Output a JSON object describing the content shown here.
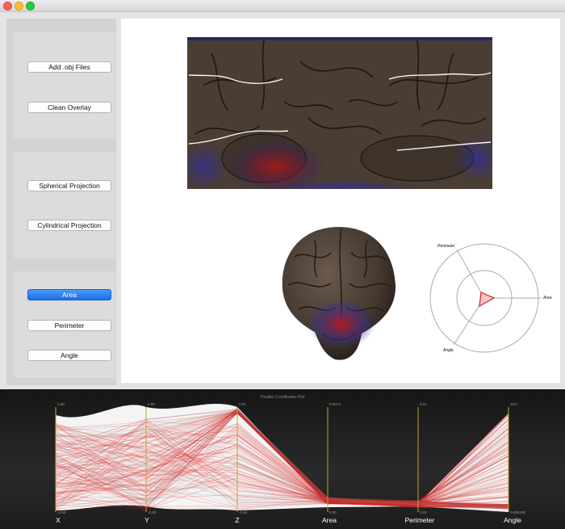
{
  "sidebar": {
    "add_obj_label": "Add .obj Files",
    "clean_overlay_label": "Clean Overlay",
    "spherical_label": "Spherical Projection",
    "cylindrical_label": "Cylindrical Projection",
    "area_label": "Area",
    "perimeter_label": "Perimeter",
    "angle_label": "Angle"
  },
  "radar": {
    "axes": [
      "Perimeter",
      "Area",
      "Angle"
    ]
  },
  "pcp": {
    "title": "Parallel Coordinates Plot",
    "axes": [
      {
        "label": "X",
        "max": "2.60",
        "min": "-2.60"
      },
      {
        "label": "Y",
        "max": "2.60",
        "min": "-2.60"
      },
      {
        "label": "Z",
        "max": "2.60",
        "min": "-2.60"
      },
      {
        "label": "Area",
        "max": "0.0074",
        "min": "0.00"
      },
      {
        "label": "Perimeter",
        "max": "0.21",
        "min": "0.00"
      },
      {
        "label": "Angle",
        "max": "33.5",
        "min": "0.000198"
      }
    ]
  },
  "colors": {
    "accent": "#1d6ee6",
    "brain": "#4a3d33",
    "highlight": "#b01818",
    "axis": "#c8a030"
  }
}
